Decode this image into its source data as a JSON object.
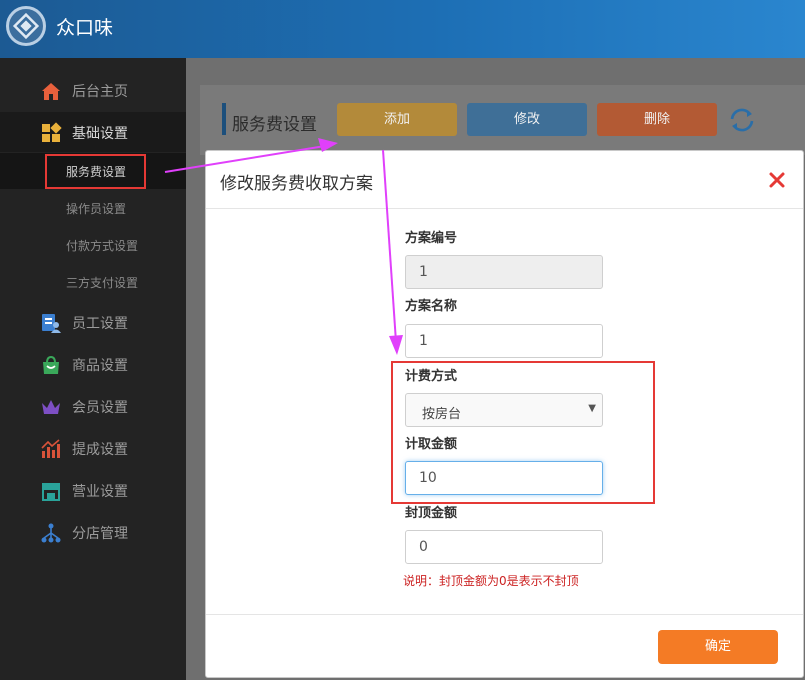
{
  "app": {
    "title": "众口味"
  },
  "sidebar": {
    "items": [
      {
        "label": "后台主页",
        "icon": "home-icon"
      },
      {
        "label": "基础设置",
        "icon": "settings-blocks-icon"
      },
      {
        "label": "员工设置",
        "icon": "staff-icon"
      },
      {
        "label": "商品设置",
        "icon": "shopping-bag-icon"
      },
      {
        "label": "会员设置",
        "icon": "crown-icon"
      },
      {
        "label": "提成设置",
        "icon": "commission-chart-icon"
      },
      {
        "label": "营业设置",
        "icon": "store-icon"
      },
      {
        "label": "分店管理",
        "icon": "branch-network-icon"
      }
    ],
    "subitems": [
      {
        "label": "服务费设置"
      },
      {
        "label": "操作员设置"
      },
      {
        "label": "付款方式设置"
      },
      {
        "label": "三方支付设置"
      }
    ]
  },
  "panel": {
    "title": "服务费设置",
    "add_label": "添加",
    "edit_label": "修改",
    "delete_label": "删除"
  },
  "modal": {
    "title": "修改服务费收取方案",
    "fields": {
      "code_label": "方案编号",
      "code_value": "1",
      "name_label": "方案名称",
      "name_value": "1",
      "billing_label": "计费方式",
      "billing_value": "按房台",
      "amount_label": "计取金额",
      "amount_value": "10",
      "cap_label": "封顶金额",
      "cap_value": "0"
    },
    "note": "说明：封顶金额为0是表示不封顶",
    "confirm_label": "确定"
  },
  "colors": {
    "header": "#1d6fb5",
    "sidebar": "#232323",
    "highlight": "#e53935",
    "arrow": "#e040fb",
    "confirm": "#f47b25"
  }
}
